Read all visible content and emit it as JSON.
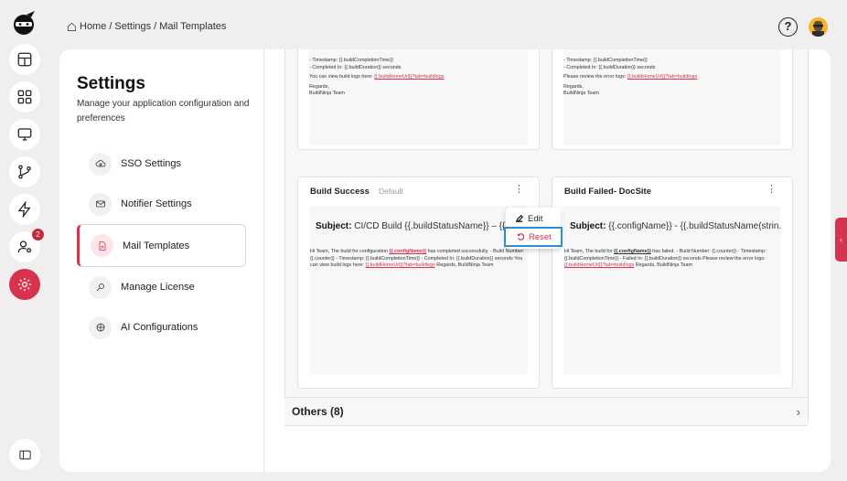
{
  "breadcrumb": {
    "home": "Home",
    "sep1": "/",
    "settings": "Settings",
    "sep2": "/",
    "current": "Mail Templates"
  },
  "header": {
    "help_glyph": "?"
  },
  "notifications": {
    "count": "2"
  },
  "settings": {
    "title": "Settings",
    "description": "Manage your application configuration and preferences",
    "nav": [
      {
        "label": "SSO Settings",
        "icon": "cloud-lock-icon"
      },
      {
        "label": "Notifier Settings",
        "icon": "mail-icon"
      },
      {
        "label": "Mail Templates",
        "icon": "document-icon"
      },
      {
        "label": "Manage License",
        "icon": "key-icon"
      },
      {
        "label": "AI Configurations",
        "icon": "ai-icon"
      }
    ]
  },
  "top_cards": {
    "left": {
      "line1": "- Timestamp: {{.buildCompletionTime}}",
      "line2": "- Completed In: {{.buildDuration}} seconds",
      "line3_prefix": "You can view build logs here: ",
      "line3_link": "{{.buildHomeUrl}}?tab=buildlogs",
      "line4": "Regards,",
      "line5": "BuildNinja Team"
    },
    "right": {
      "line1": "- Timestamp: {{.buildCompletionTime}}",
      "line2": "- Completed In: {{.buildDuration}} seconds",
      "line3_prefix": "Please review the error logs: ",
      "line3_link": "{{.buildHomeUrl}}?tab=buildlogs",
      "line4": "Regards,",
      "line5": "BuildNinja Team"
    }
  },
  "cards": [
    {
      "title": "Build Success",
      "tag": "Default",
      "subject_label": "Subject:",
      "subject": "CI/CD Build {{.buildStatusName}} – {{.configName}}",
      "body_a": "Hi Team, The build for configuration ",
      "body_link1": "{{.configName}}",
      "body_b": " has completed successfully. - Build Number: {{.counter}} - Timestamp: {{.buildCompletionTime}} - Completed In: {{.buildDuration}} seconds You can view build logs here: ",
      "body_link2": "{{.buildHomeUrl}}?tab=buildlogs",
      "body_c": " Regards, BuildNinja Team"
    },
    {
      "title": "Build Failed- DocSite",
      "tag": "",
      "subject_label": "Subject:",
      "subject": "{{.configName}} - {{.buildStatusName(strin...",
      "body_a": "Hi Team, The build for ",
      "body_link1": "{{.configName}}",
      "body_b": " has failed. - Build Number: {{.counter}} - Timestamp: {{.buildCompletionTime}} - Failed In: {{.buildDuration}} seconds Please review the error logs: ",
      "body_link2": "{{.buildHomeUrl}}?tab=buildlogs",
      "body_c": " Regards, BuildNinja Team"
    }
  ],
  "context_menu": {
    "edit": "Edit",
    "reset": "Reset"
  },
  "others": {
    "label": "Others (8)",
    "chevron": "›"
  },
  "collapse_tab": {
    "glyph": "‹"
  },
  "kebab_glyph": "⋮",
  "colors": {
    "accent": "#d6334e",
    "highlight": "#2a8fd9",
    "background": "#f0eeef"
  }
}
